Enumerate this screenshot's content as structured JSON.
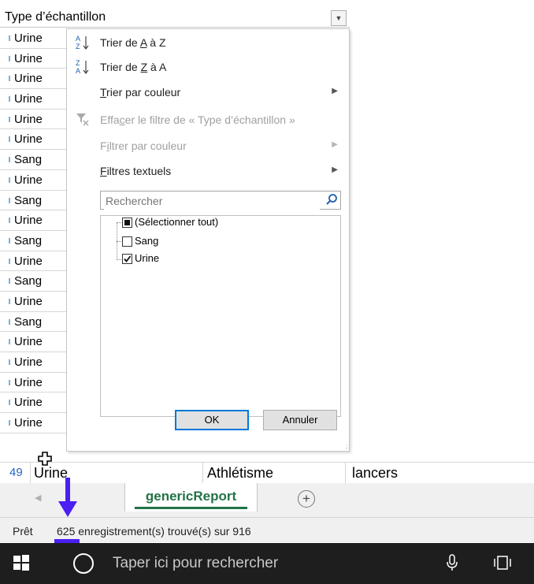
{
  "column_header": {
    "title": "Type d’échantillon"
  },
  "cells": [
    "Urine",
    "Urine",
    "Urine",
    "Urine",
    "Urine",
    "Urine",
    "Sang",
    "Urine",
    "Sang",
    "Urine",
    "Sang",
    "Urine",
    "Sang",
    "Urine",
    "Sang",
    "Urine",
    "Urine",
    "Urine",
    "Urine",
    "Urine"
  ],
  "filter_menu": {
    "sort_az": {
      "pre": "Trier de ",
      "a": "A",
      "mid": " à ",
      "b": "Z",
      "icon": "sort-az-icon"
    },
    "sort_za": {
      "pre": "Trier de ",
      "a": "Z",
      "mid": " à ",
      "b": "A",
      "icon": "sort-za-icon"
    },
    "sort_color": {
      "u": "T",
      "rest": "rier par couleur"
    },
    "clear_filter": {
      "pre": "Effa",
      "u": "c",
      "rest": "er le filtre de « Type d’échantillon »"
    },
    "filter_color": {
      "pre": "F",
      "u": "i",
      "rest": "ltrer par couleur"
    },
    "text_filters": {
      "u": "F",
      "rest": "iltres textuels"
    },
    "search": {
      "placeholder": "Rechercher"
    },
    "items": [
      {
        "label": "(Sélectionner tout)",
        "state": "partial"
      },
      {
        "label": "Sang",
        "state": "unchecked"
      },
      {
        "label": "Urine",
        "state": "checked"
      }
    ],
    "ok_label": "OK",
    "cancel_label": "Annuler"
  },
  "row49": {
    "number": "49",
    "col_a": "Urine",
    "col_b": "Athlétisme",
    "col_c": "lancers"
  },
  "sheet": {
    "tab_label": "genericReport",
    "add_symbol": "+"
  },
  "status": {
    "ready": "Prêt",
    "count": "625",
    "records_text": " enregistrement(s) trouvé(s) sur 916"
  },
  "taskbar": {
    "search_placeholder": "Taper ici pour rechercher"
  },
  "colors": {
    "excel_green": "#217346",
    "accent_blue": "#0078d7",
    "annotation_purple": "#4b1ff2"
  }
}
